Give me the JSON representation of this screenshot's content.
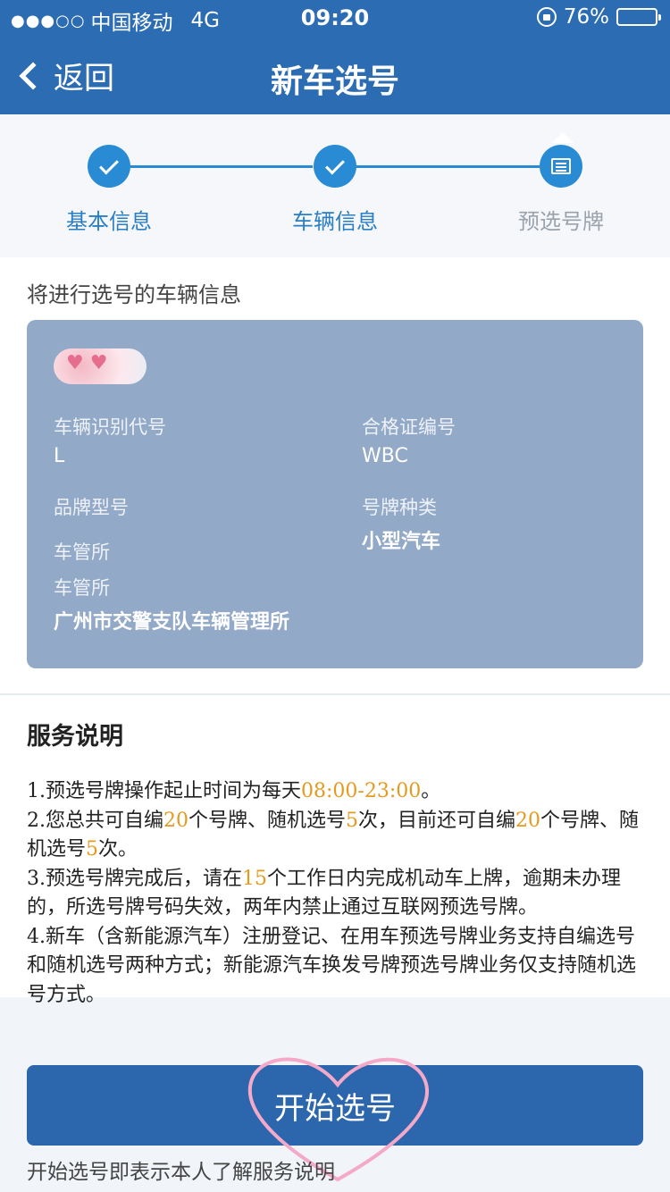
{
  "status_bar": {
    "signal_dots": "●●●○○",
    "carrier": "中国移动",
    "network": "4G",
    "time": "09:20",
    "battery": "76%",
    "battery_level": 0.76
  },
  "nav": {
    "back_label": "返回",
    "title": "新车选号"
  },
  "steps": [
    {
      "label": "基本信息",
      "state": "done",
      "icon": "check-icon"
    },
    {
      "label": "车辆信息",
      "state": "done",
      "icon": "check-icon"
    },
    {
      "label": "预选号牌",
      "state": "current",
      "icon": "document-icon"
    }
  ],
  "vehicle": {
    "section_title": "将进行选号的车辆信息",
    "vin_label": "车辆识别代号",
    "vin_value": "L",
    "cert_label": "合格证编号",
    "cert_value": "WBC",
    "brand_label": "品牌型号",
    "plate_type_label": "号牌种类",
    "plate_type_value": "小型汽车",
    "office_label_1": "车管所",
    "office_label_2": "车管所",
    "office_value": "广州市交警支队车辆管理所"
  },
  "service": {
    "title": "服务说明",
    "items": [
      {
        "a": "1.预选号牌操作起止时间为每天",
        "b": "08:00-23:00",
        "c": "。"
      },
      {
        "a": "2.您总共可自编",
        "b": "20",
        "c": "个号牌、随机选号",
        "d": "5",
        "e": "次，目前还可自编",
        "f": "20",
        "g": "个号牌、随机选号",
        "h": "5",
        "i": "次。"
      },
      {
        "a": "3.预选号牌完成后，请在",
        "b": "15",
        "c": "个工作日内完成机动车上牌，逾期未办理的，所选号牌号码失效，两年内禁止通过互联网预选号牌。"
      },
      {
        "a": "4.新车（含新能源汽车）注册登记、在用车预选号牌业务支持自编选号和随机选号两种方式；新能源汽车换发号牌预选号牌业务仅支持随机选号方式。"
      }
    ]
  },
  "actions": {
    "start_label": "开始选号",
    "note": "开始选号即表示本人了解服务说明"
  },
  "colors": {
    "header": "#2c6cb3",
    "accent": "#2a8bd5",
    "card": "#92a9c8",
    "highlight": "#e59a1e",
    "button": "#2c66ad"
  }
}
